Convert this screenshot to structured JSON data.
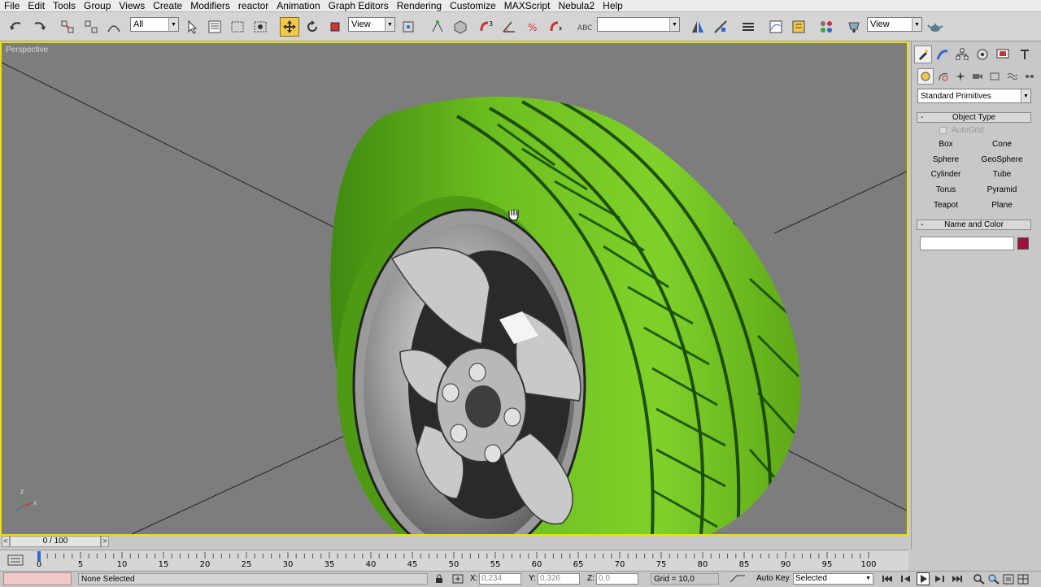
{
  "menu": [
    "File",
    "Edit",
    "Tools",
    "Group",
    "Views",
    "Create",
    "Modifiers",
    "reactor",
    "Animation",
    "Graph Editors",
    "Rendering",
    "Customize",
    "MAXScript",
    "Nebula2",
    "Help"
  ],
  "toolbar": {
    "selection_filter": "All",
    "ref_coord": "View",
    "named_sel": "",
    "view_combo": "View"
  },
  "viewport": {
    "label": "Perspective"
  },
  "command_panel": {
    "category": "Standard Primitives",
    "object_type_title": "Object Type",
    "autogrid_label": "AutoGrid",
    "primitives": [
      "Box",
      "Cone",
      "Sphere",
      "GeoSphere",
      "Cylinder",
      "Tube",
      "Torus",
      "Pyramid",
      "Teapot",
      "Plane"
    ],
    "name_color_title": "Name and Color",
    "name_value": "",
    "color": "#a0103c"
  },
  "timeline": {
    "frame_display": "0 / 100",
    "ticks": [
      "0",
      "5",
      "10",
      "15",
      "20",
      "25",
      "30",
      "35",
      "40",
      "45",
      "50",
      "55",
      "60",
      "65",
      "70",
      "75",
      "80",
      "85",
      "90",
      "95",
      "100"
    ]
  },
  "status": {
    "selection": "None Selected",
    "x_label": "X:",
    "x_value": "0,234",
    "y_label": "Y:",
    "y_value": "0,326",
    "z_label": "Z:",
    "z_value": "0,0",
    "grid": "Grid = 10,0",
    "auto_key": "Auto Key",
    "key_mode": "Selected"
  },
  "colors": {
    "viewport_border": "#f0e000",
    "tire": "#6cbf1f",
    "active_tool": "#f2c94c"
  }
}
